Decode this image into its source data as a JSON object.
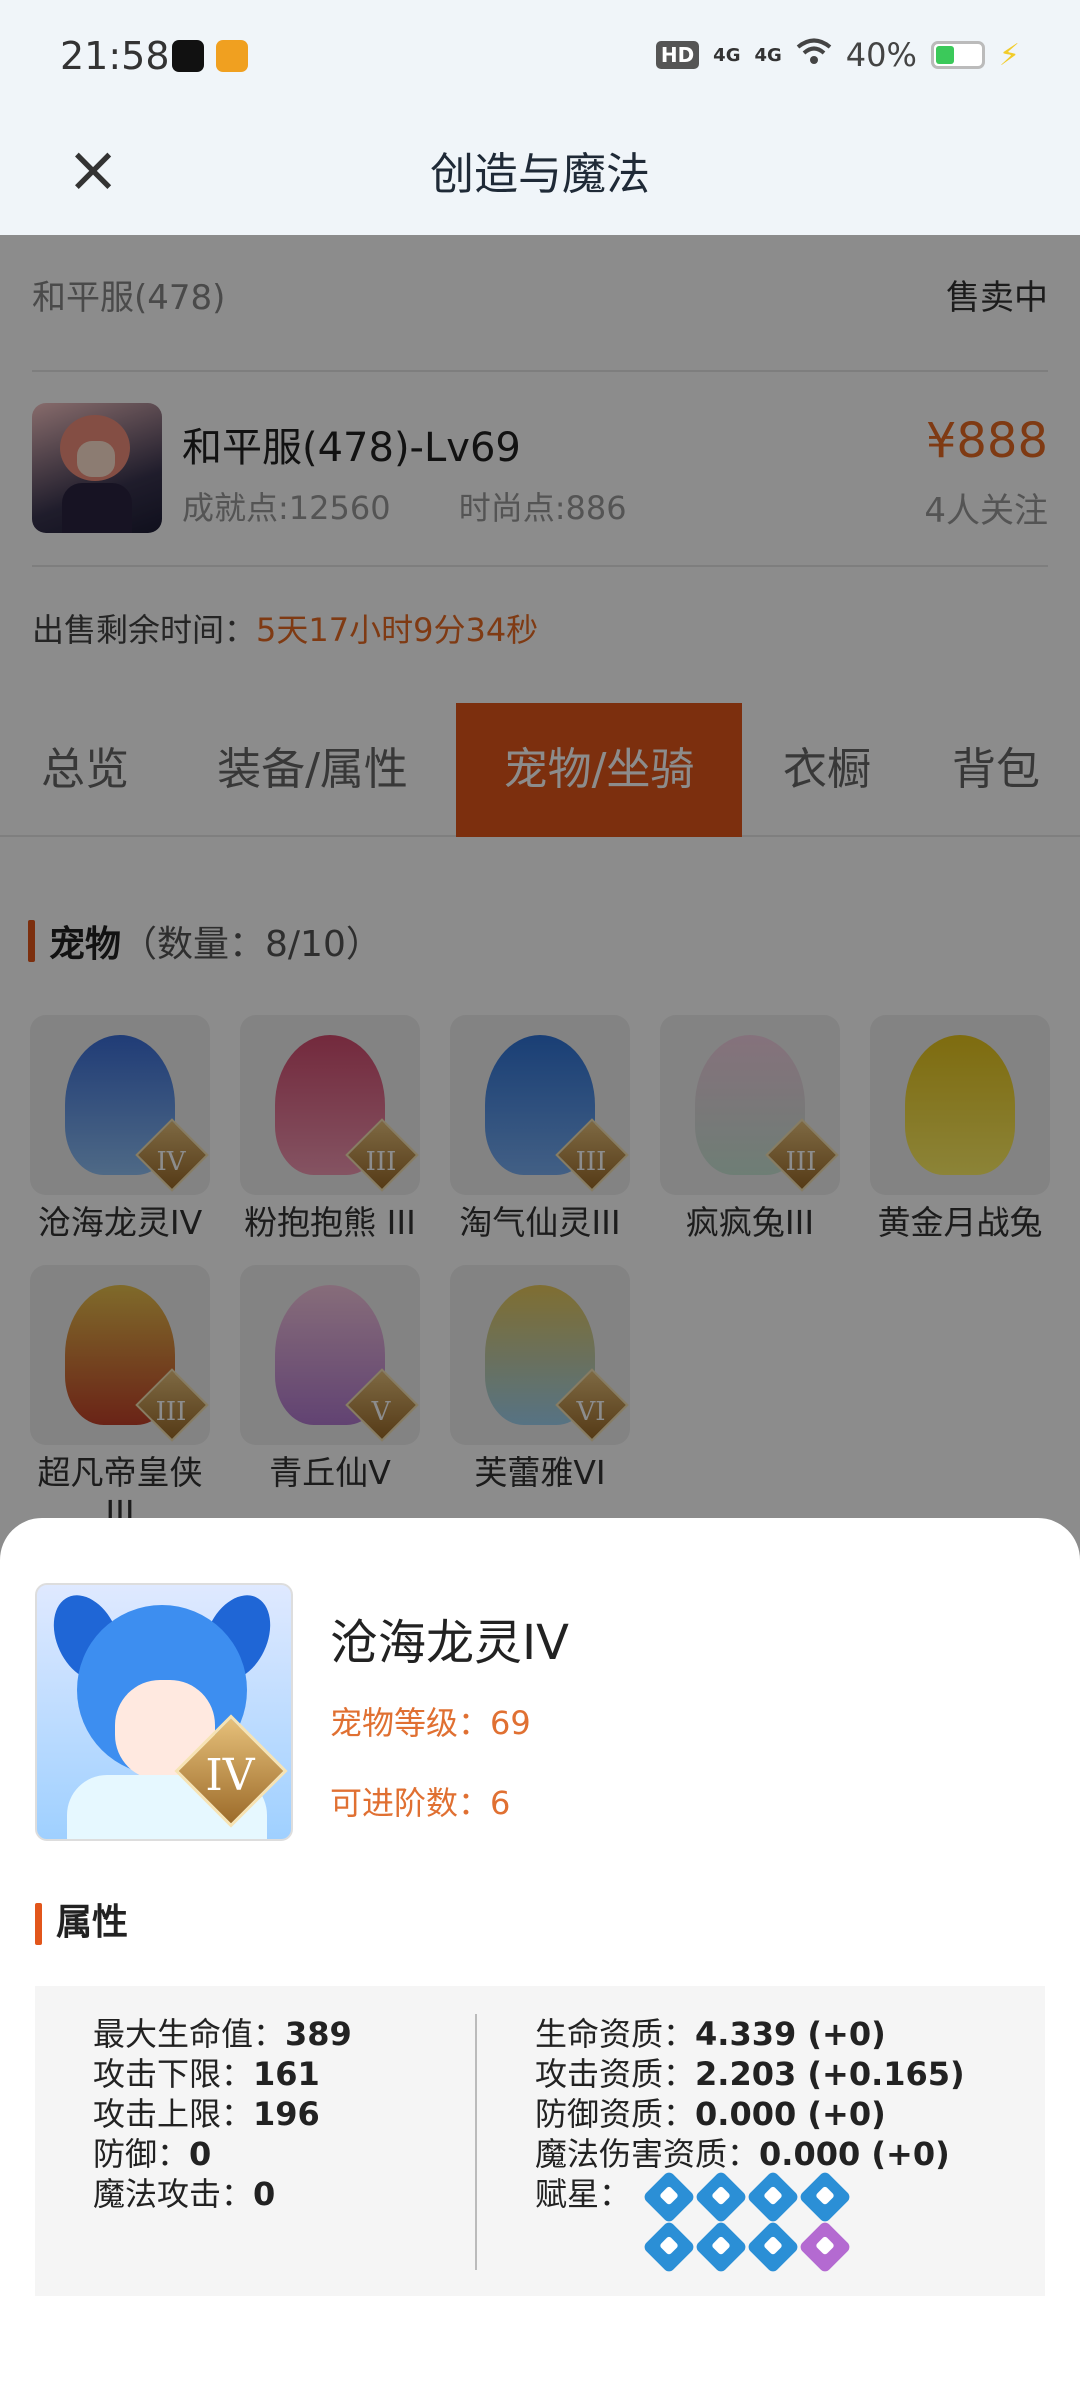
{
  "status": {
    "time": "21:58",
    "hd": "HD",
    "net1": "4G",
    "net2": "4G",
    "battery": "40%",
    "battery_level": 0.4,
    "accent_green": "#3bc95a"
  },
  "header": {
    "title": "创造与魔法",
    "close_icon": "close-icon"
  },
  "server": {
    "name": "和平服(478)",
    "status": "售卖中"
  },
  "role": {
    "name": "和平服(478)-Lv69",
    "achievement": "成就点:12560",
    "fashion": "时尚点:886",
    "price": "¥888",
    "followers": "4人关注"
  },
  "remain": {
    "label": "出售剩余时间：",
    "value": "5天17小时9分34秒"
  },
  "tabs": [
    {
      "label": "总览"
    },
    {
      "label": "装备/属性"
    },
    {
      "label": "宠物/坐骑"
    },
    {
      "label": "衣橱"
    },
    {
      "label": "背包"
    }
  ],
  "pets_section": {
    "title": "宠物",
    "count": "（数量：8/10）"
  },
  "pets": [
    {
      "name": "沧海龙灵IV",
      "rank": "IV"
    },
    {
      "name": "粉抱抱熊 III",
      "rank": "III"
    },
    {
      "name": "淘气仙灵III",
      "rank": "III"
    },
    {
      "name": "疯疯兔III",
      "rank": "III"
    },
    {
      "name": "黄金月战兔",
      "rank": ""
    },
    {
      "name": "超凡帝皇侠III",
      "rank": "III"
    },
    {
      "name": "青丘仙V",
      "rank": "V"
    },
    {
      "name": "芙蕾雅VI",
      "rank": "VI"
    }
  ],
  "detail": {
    "name": "沧海龙灵IV",
    "rank": "IV",
    "level": "宠物等级：69",
    "advance": "可进阶数：6",
    "attr_title": "属性",
    "left": [
      {
        "label": "最大生命值：",
        "value": "389"
      },
      {
        "label": "攻击下限：",
        "value": "161"
      },
      {
        "label": "攻击上限：",
        "value": "196"
      },
      {
        "label": "防御：",
        "value": "0"
      },
      {
        "label": "魔法攻击：",
        "value": "0"
      }
    ],
    "right": [
      {
        "label": "生命资质：",
        "value": "4.339 (+0)"
      },
      {
        "label": "攻击资质：",
        "value": "2.203 (+0.165)"
      },
      {
        "label": "防御资质：",
        "value": "0.000 (+0)"
      },
      {
        "label": "魔法伤害资质：",
        "value": "0.000 (+0)"
      }
    ],
    "star_label": "赋星：",
    "stars": [
      "blue",
      "blue",
      "blue",
      "blue",
      "blue",
      "blue",
      "blue",
      "purple"
    ]
  }
}
